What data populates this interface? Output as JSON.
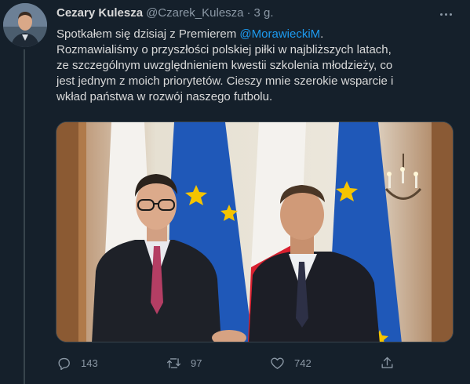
{
  "tweet": {
    "author_name": "Cezary Kulesza",
    "handle": "@Czarek_Kulesza",
    "separator": "·",
    "time": "3 g.",
    "text_lines": [
      {
        "pre": "Spotkałem się dzisiaj z Premierem ",
        "mention": "@MorawieckiM",
        "post": "."
      },
      {
        "pre": "Rozmawialiśmy o przyszłości polskiej piłki w najbliższych latach,"
      },
      {
        "pre": "ze szczególnym uwzględnieniem kwestii szkolenia młodzieży, co"
      },
      {
        "pre": "jest jednym z moich priorytetów. Cieszy mnie szerokie wsparcie i"
      },
      {
        "pre": "wkład państwa w rozwój naszego futbolu."
      }
    ],
    "stats": {
      "replies": "143",
      "retweets": "97",
      "likes": "742"
    }
  },
  "icons": {
    "more": "more-horizontal-icon",
    "reply": "reply-icon",
    "retweet": "retweet-icon",
    "like": "heart-icon",
    "share": "share-icon"
  },
  "colors": {
    "background": "#15202b",
    "text": "#d9d9d9",
    "secondary": "#8b98a5",
    "link": "#1d9bf0",
    "divider": "#38444d"
  }
}
